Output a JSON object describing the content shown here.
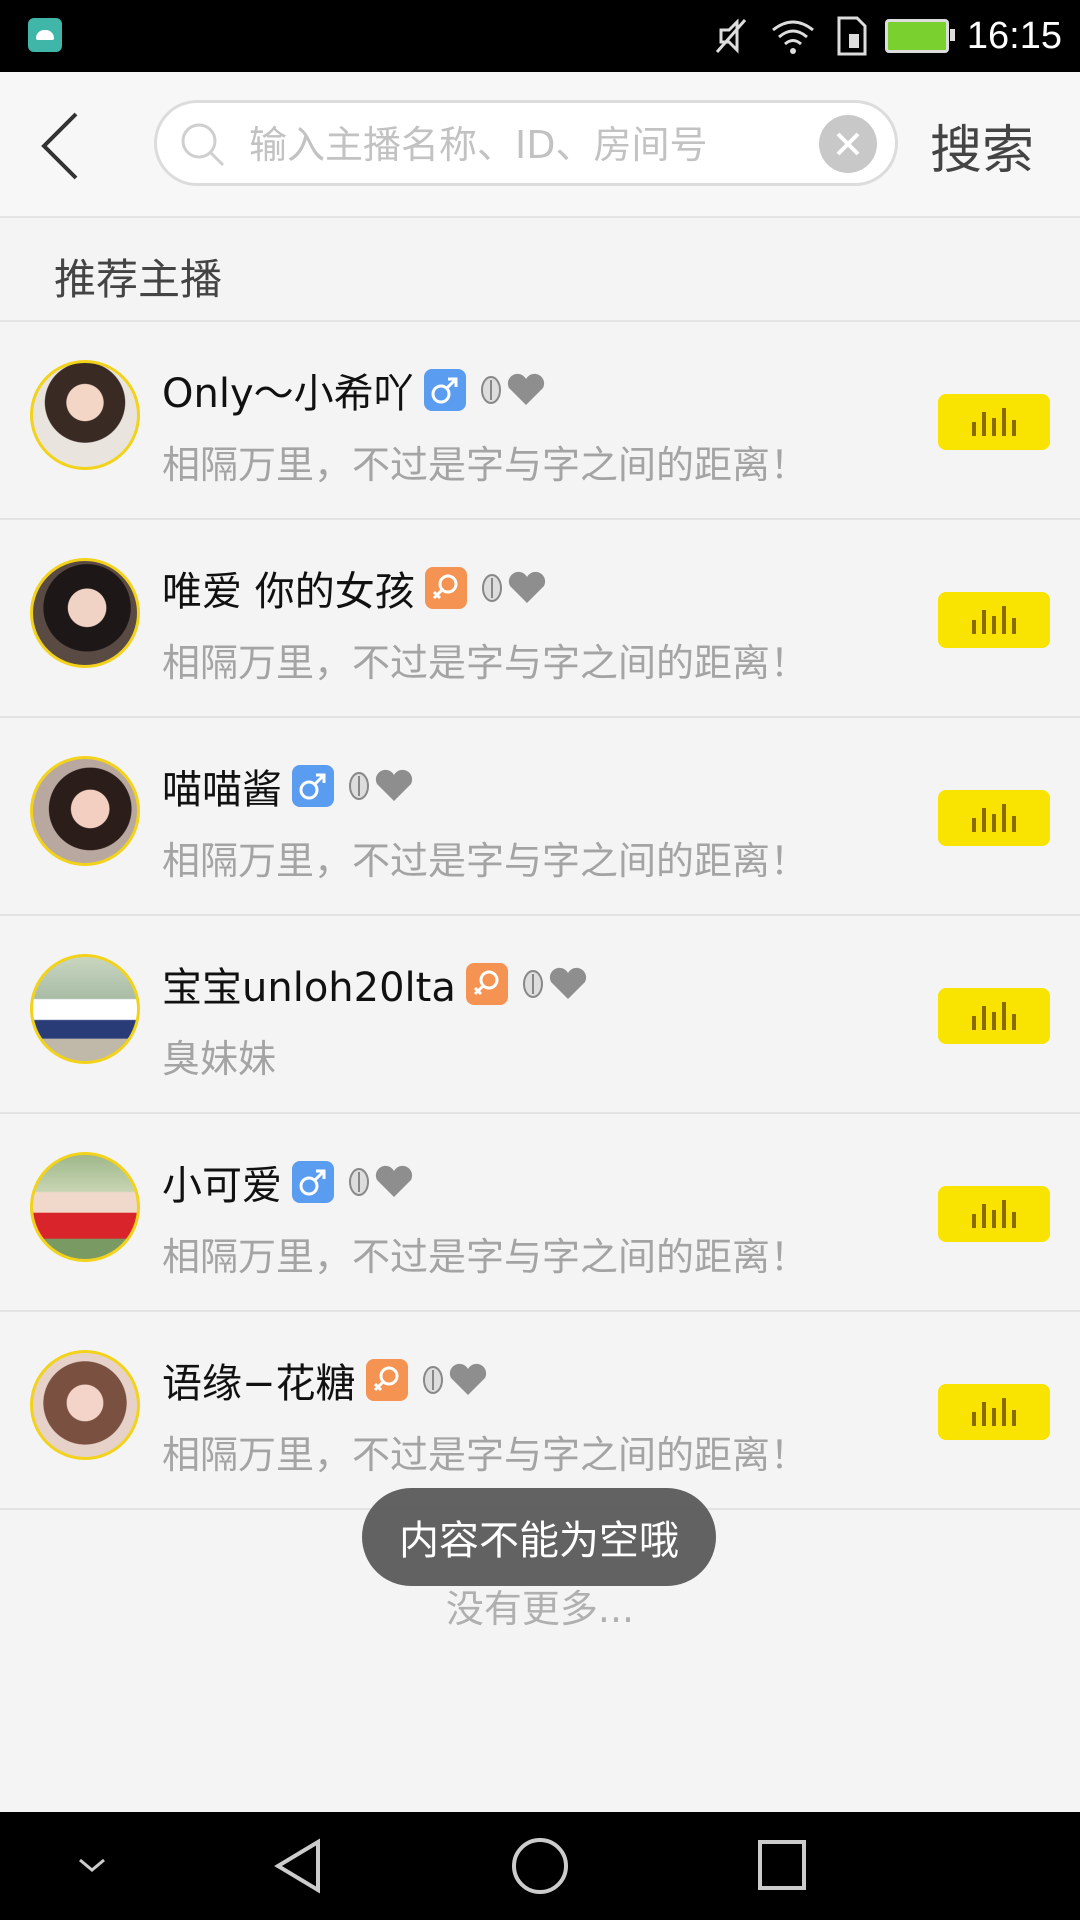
{
  "status_bar": {
    "time": "16:15",
    "icons": [
      "android-icon",
      "mute-icon",
      "wifi-icon",
      "sim-icon",
      "battery-charging-icon"
    ]
  },
  "header": {
    "back_icon": "back-arrow-icon",
    "search_placeholder": "输入主播名称、ID、房间号",
    "search_value": "",
    "search_button": "搜索"
  },
  "section": {
    "title": "推荐主播"
  },
  "anchors": [
    {
      "name": "Only～小希吖",
      "gender": "male",
      "signature": "相隔万里，不过是字与字之间的距离！"
    },
    {
      "name": "唯爱 你的女孩",
      "gender": "female",
      "signature": "相隔万里，不过是字与字之间的距离！"
    },
    {
      "name": "喵喵酱",
      "gender": "male",
      "signature": "相隔万里，不过是字与字之间的距离！"
    },
    {
      "name": "宝宝unloh20lta",
      "gender": "female",
      "signature": "臭妹妹"
    },
    {
      "name": "小可爱",
      "gender": "male",
      "signature": "相隔万里，不过是字与字之间的距离！"
    },
    {
      "name": "语缘−花糖",
      "gender": "female",
      "signature": "相隔万里，不过是字与字之间的距离！"
    }
  ],
  "footer": {
    "no_more": "没有更多..."
  },
  "toast": {
    "message": "内容不能为空哦"
  },
  "colors": {
    "accent_yellow": "#f8e400",
    "avatar_ring": "#f3d21b",
    "male_badge": "#5a9cf0",
    "female_badge": "#f59353"
  },
  "nav_bar": {
    "icons": [
      "hide-keyboard-icon",
      "back-triangle-icon",
      "home-circle-icon",
      "recents-square-icon"
    ]
  }
}
